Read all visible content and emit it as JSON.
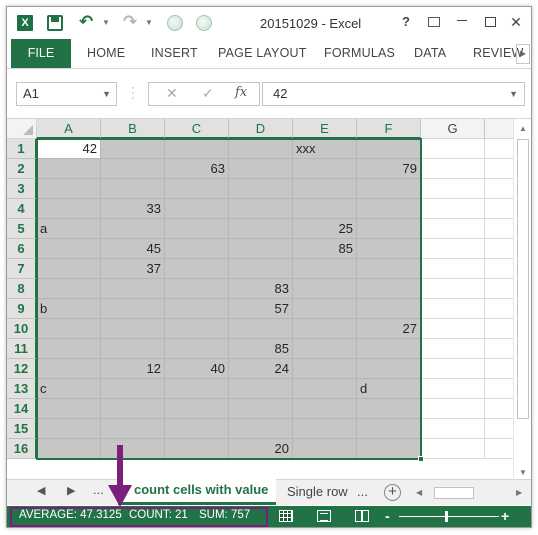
{
  "window": {
    "title": "20151029 - Excel",
    "help": "?",
    "close_glyph": "✕"
  },
  "quick_access": {
    "app_icon": "excel-icon",
    "save_icon": "save-icon",
    "undo_icon": "undo-icon",
    "redo_icon": "redo-icon"
  },
  "ribbon": {
    "tabs": [
      "FILE",
      "HOME",
      "INSERT",
      "PAGE LAYOUT",
      "FORMULAS",
      "DATA",
      "REVIEW"
    ],
    "active_tab": "FILE",
    "accent_color": "#217346"
  },
  "formula_bar": {
    "name_box": "A1",
    "cancel_glyph": "✕",
    "enter_glyph": "✓",
    "fx_label": "fx",
    "value": "42"
  },
  "grid": {
    "columns": [
      "A",
      "B",
      "C",
      "D",
      "E",
      "F",
      "G"
    ],
    "rows": [
      "1",
      "2",
      "3",
      "4",
      "5",
      "6",
      "7",
      "8",
      "9",
      "10",
      "11",
      "12",
      "13",
      "14",
      "15",
      "16"
    ],
    "selected_range": "A1:F16",
    "cells": [
      [
        "42",
        "",
        "",
        "",
        "xxx",
        ""
      ],
      [
        "",
        "",
        "63",
        "",
        "",
        "79"
      ],
      [
        "",
        "",
        "",
        "",
        "",
        ""
      ],
      [
        "",
        "33",
        "",
        "",
        "",
        ""
      ],
      [
        "a",
        "",
        "",
        "",
        "25",
        ""
      ],
      [
        "",
        "45",
        "",
        "",
        "85",
        ""
      ],
      [
        "",
        "37",
        "",
        "",
        "",
        ""
      ],
      [
        "",
        "",
        "",
        "83",
        "",
        ""
      ],
      [
        "b",
        "",
        "",
        "57",
        "",
        ""
      ],
      [
        "",
        "",
        "",
        "",
        "",
        "27"
      ],
      [
        "",
        "",
        "",
        "85",
        "",
        ""
      ],
      [
        "",
        "12",
        "40",
        "24",
        "",
        ""
      ],
      [
        "c",
        "",
        "",
        "",
        "",
        "d"
      ],
      [
        "",
        "",
        "",
        "",
        "",
        ""
      ],
      [
        "",
        "",
        "",
        "",
        "",
        ""
      ],
      [
        "",
        "",
        "",
        "20",
        "",
        ""
      ]
    ]
  },
  "sheets": {
    "nav_prev": "◀",
    "nav_next": "▶",
    "nav_more": "...",
    "active": "count cells with value",
    "other": "Single row",
    "other_more": "...",
    "add": "+"
  },
  "status": {
    "average": "AVERAGE: 47.3125",
    "count": "COUNT: 21",
    "sum": "SUM: 757",
    "zoom_minus": "-",
    "zoom_plus": "+",
    "bar_color": "#217346",
    "highlight_color": "#7b1f7b"
  }
}
